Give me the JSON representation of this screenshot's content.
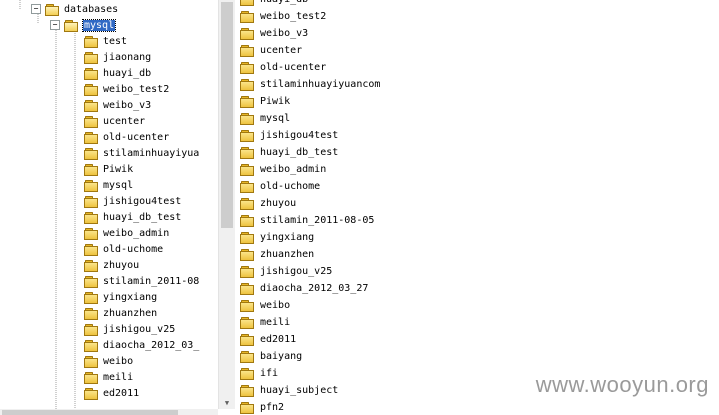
{
  "tree": {
    "root_label": "databases",
    "selected_label": "mysql",
    "children": [
      "test",
      "jiaonang",
      "huayi_db",
      "weibo_test2",
      "weibo_v3",
      "ucenter",
      "old-ucenter",
      "stilaminhuayiyua",
      "Piwik",
      "mysql",
      "jishigou4test",
      "huayi_db_test",
      "weibo_admin",
      "old-uchome",
      "zhuyou",
      "stilamin_2011-08",
      "yingxiang",
      "zhuanzhen",
      "jishigou_v25",
      "diaocha_2012_03_",
      "weibo",
      "meili",
      "ed2011"
    ]
  },
  "list": {
    "partial_top": "huayi_db",
    "items": [
      "weibo_test2",
      "weibo_v3",
      "ucenter",
      "old-ucenter",
      "stilaminhuayiyuancom",
      "Piwik",
      "mysql",
      "jishigou4test",
      "huayi_db_test",
      "weibo_admin",
      "old-uchome",
      "zhuyou",
      "stilamin_2011-08-05",
      "yingxiang",
      "zhuanzhen",
      "jishigou_v25",
      "diaocha_2012_03_27",
      "weibo",
      "meili",
      "ed2011",
      "baiyang",
      "ifi",
      "huayi_subject",
      "pfn2"
    ]
  },
  "watermark": "www.wooyun.org",
  "icons": {
    "folder": "folder-icon",
    "folder_open": "folder-open-icon",
    "expander": "expander-minus-icon",
    "scroll_down": "scroll-down-arrow-icon"
  },
  "colors": {
    "folder": "#eec33f",
    "selection": "#316ac5",
    "scrollbar": "#f0f0f0"
  }
}
